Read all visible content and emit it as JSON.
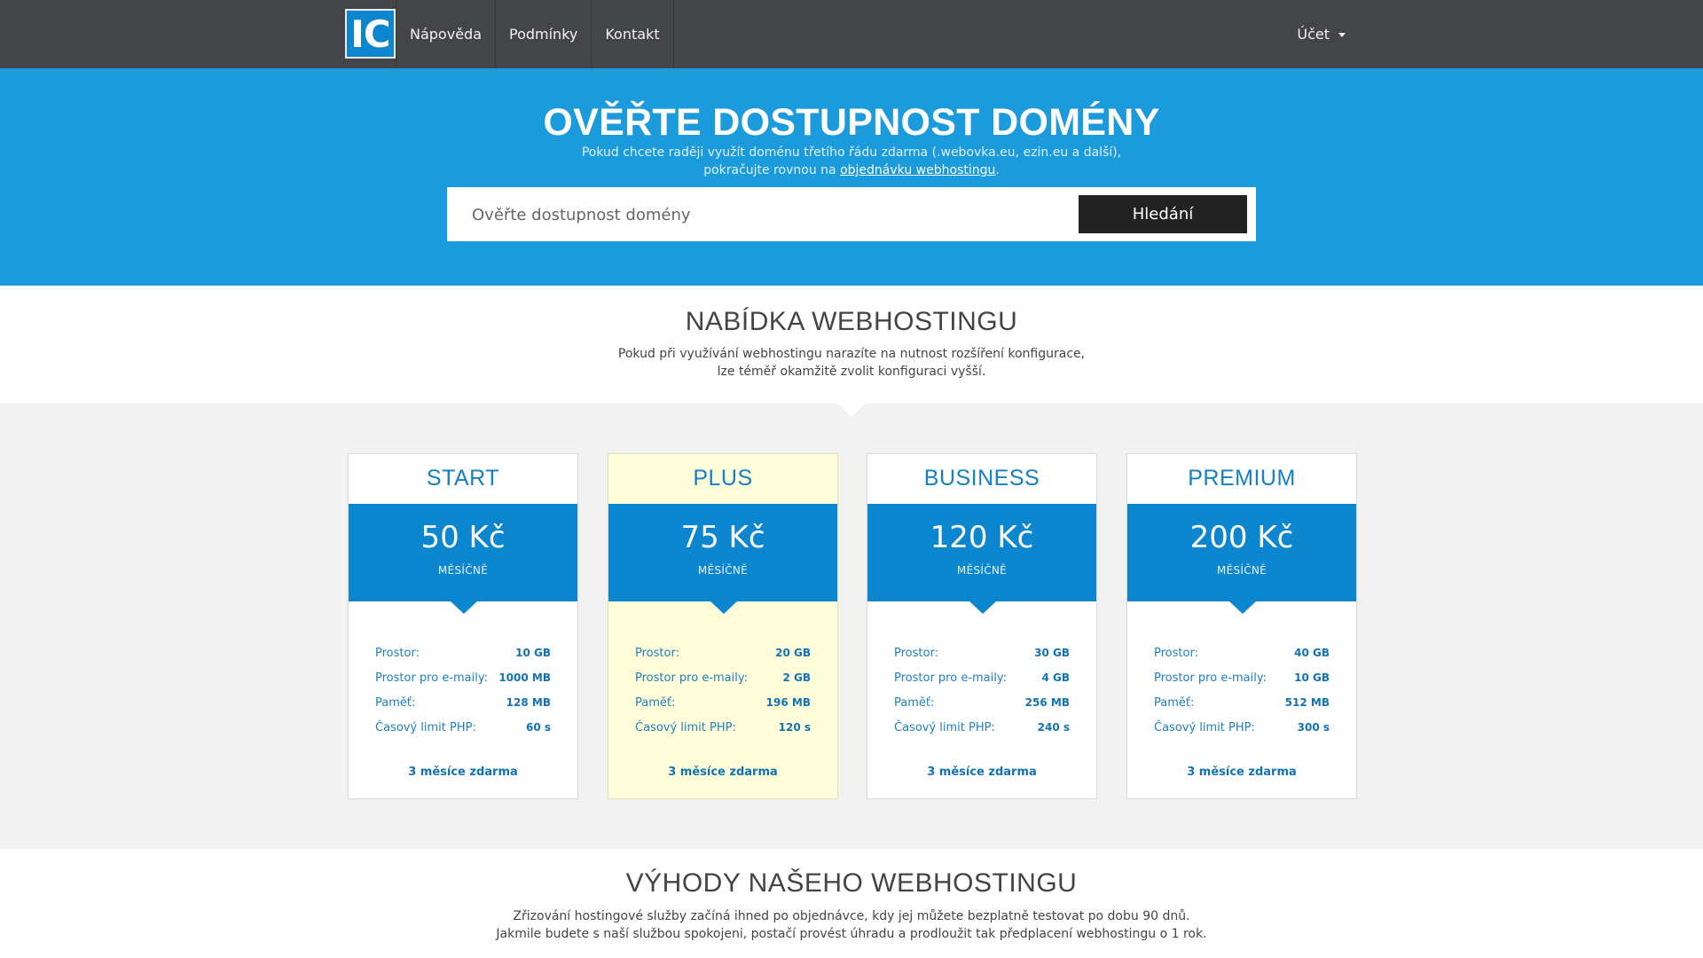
{
  "nav": {
    "logo_text": "IC",
    "links": [
      "Nápověda",
      "Podmínky",
      "Kontakt"
    ],
    "account_label": "Účet"
  },
  "hero": {
    "title": "OVĚŘTE DOSTUPNOST DOMÉNY",
    "subtitle_line1": "Pokud chcete raději využít doménu třetího řádu zdarma (.webovka.eu, ezin.eu a další),",
    "subtitle_line2_prefix": "pokračujte rovnou na ",
    "subtitle_link": "objednávku webhostingu",
    "subtitle_line2_suffix": ".",
    "search_placeholder": "Ověřte dostupnost domény",
    "search_button": "Hledání"
  },
  "offer": {
    "title": "NABÍDKA WEBHOSTINGU",
    "subtitle_line1": "Pokud při využívání webhostingu narazíte na nutnost rozšíření konfigurace,",
    "subtitle_line2": "lze téměř okamžitě zvolit konfiguraci vyšší."
  },
  "plans": [
    {
      "name": "START",
      "price": "50 Kč",
      "period": "MĚSÍČNĚ",
      "featured": false,
      "specs": [
        {
          "label": "Prostor:",
          "value": "10 GB"
        },
        {
          "label": "Prostor pro e-maily:",
          "value": "1000 MB"
        },
        {
          "label": "Paměť:",
          "value": "128 MB"
        },
        {
          "label": "Časový limit PHP:",
          "value": "60 s"
        }
      ],
      "promo": "3 měsíce zdarma"
    },
    {
      "name": "PLUS",
      "price": "75 Kč",
      "period": "MĚSÍČNĚ",
      "featured": true,
      "specs": [
        {
          "label": "Prostor:",
          "value": "20 GB"
        },
        {
          "label": "Prostor pro e-maily:",
          "value": "2 GB"
        },
        {
          "label": "Paměť:",
          "value": "196 MB"
        },
        {
          "label": "Časový limit PHP:",
          "value": "120 s"
        }
      ],
      "promo": "3 měsíce zdarma"
    },
    {
      "name": "BUSINESS",
      "price": "120 Kč",
      "period": "MĚSÍČNĚ",
      "featured": false,
      "specs": [
        {
          "label": "Prostor:",
          "value": "30 GB"
        },
        {
          "label": "Prostor pro e-maily:",
          "value": "4 GB"
        },
        {
          "label": "Paměť:",
          "value": "256 MB"
        },
        {
          "label": "Časový limit PHP:",
          "value": "240 s"
        }
      ],
      "promo": "3 měsíce zdarma"
    },
    {
      "name": "PREMIUM",
      "price": "200 Kč",
      "period": "MĚSÍČNĚ",
      "featured": false,
      "specs": [
        {
          "label": "Prostor:",
          "value": "40 GB"
        },
        {
          "label": "Prostor pro e-maily:",
          "value": "10 GB"
        },
        {
          "label": "Paměť:",
          "value": "512 MB"
        },
        {
          "label": "Časový limit PHP:",
          "value": "300 s"
        }
      ],
      "promo": "3 měsíce zdarma"
    }
  ],
  "benefits": {
    "title": "VÝHODY NAŠEHO WEBHOSTINGU",
    "subtitle_line1": "Zřizování hostingové služby začíná ihned po objednávce, kdy jej můžete bezplatně testovat po dobu 90 dnů.",
    "subtitle_line2": "Jakmile budete s naší službou spokojeni, postačí provést úhradu a prodloužit tak předplacení webhostingu o 1 rok."
  },
  "colors": {
    "navbar": "#444548",
    "hero": "#1b9bdb",
    "accent": "#0c86cf",
    "featured_bg": "#fefdd9"
  }
}
